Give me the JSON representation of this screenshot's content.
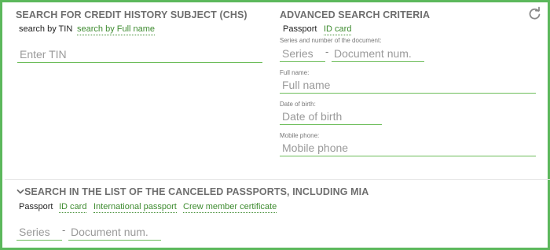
{
  "chs": {
    "title": "SEARCH FOR CREDIT HISTORY SUBJECT (CHS)",
    "tabs": [
      "search by TIN",
      "search by Full name"
    ],
    "tin_placeholder": "Enter TIN"
  },
  "advanced": {
    "title": "ADVANCED SEARCH CRITERIA",
    "tabs": [
      "Passport",
      "ID card"
    ],
    "doc_label": "Series and number of the document:",
    "series_placeholder": "Series",
    "dash": "-",
    "docnum_placeholder": "Document num.",
    "fullname_label": "Full name:",
    "fullname_placeholder": "Full name",
    "dob_label": "Date of birth:",
    "dob_placeholder": "Date of birth",
    "mobile_label": "Mobile phone:",
    "mobile_placeholder": "Mobile phone"
  },
  "canceled": {
    "title": "SEARCH IN THE LIST OF THE CANCELED PASSPORTS, INCLUDING MIA",
    "tabs": [
      "Passport",
      "ID card",
      "International passport",
      "Crew member certificate"
    ],
    "series_placeholder": "Series",
    "dash": "-",
    "docnum_placeholder": "Document num."
  },
  "icons": {
    "refresh": "refresh-icon",
    "chevron": "chevron-down-icon"
  },
  "colors": {
    "accent": "#5cb85c",
    "link": "#3d8b2f",
    "underline": "#6dbd5a",
    "heading": "#6e6e6e"
  }
}
